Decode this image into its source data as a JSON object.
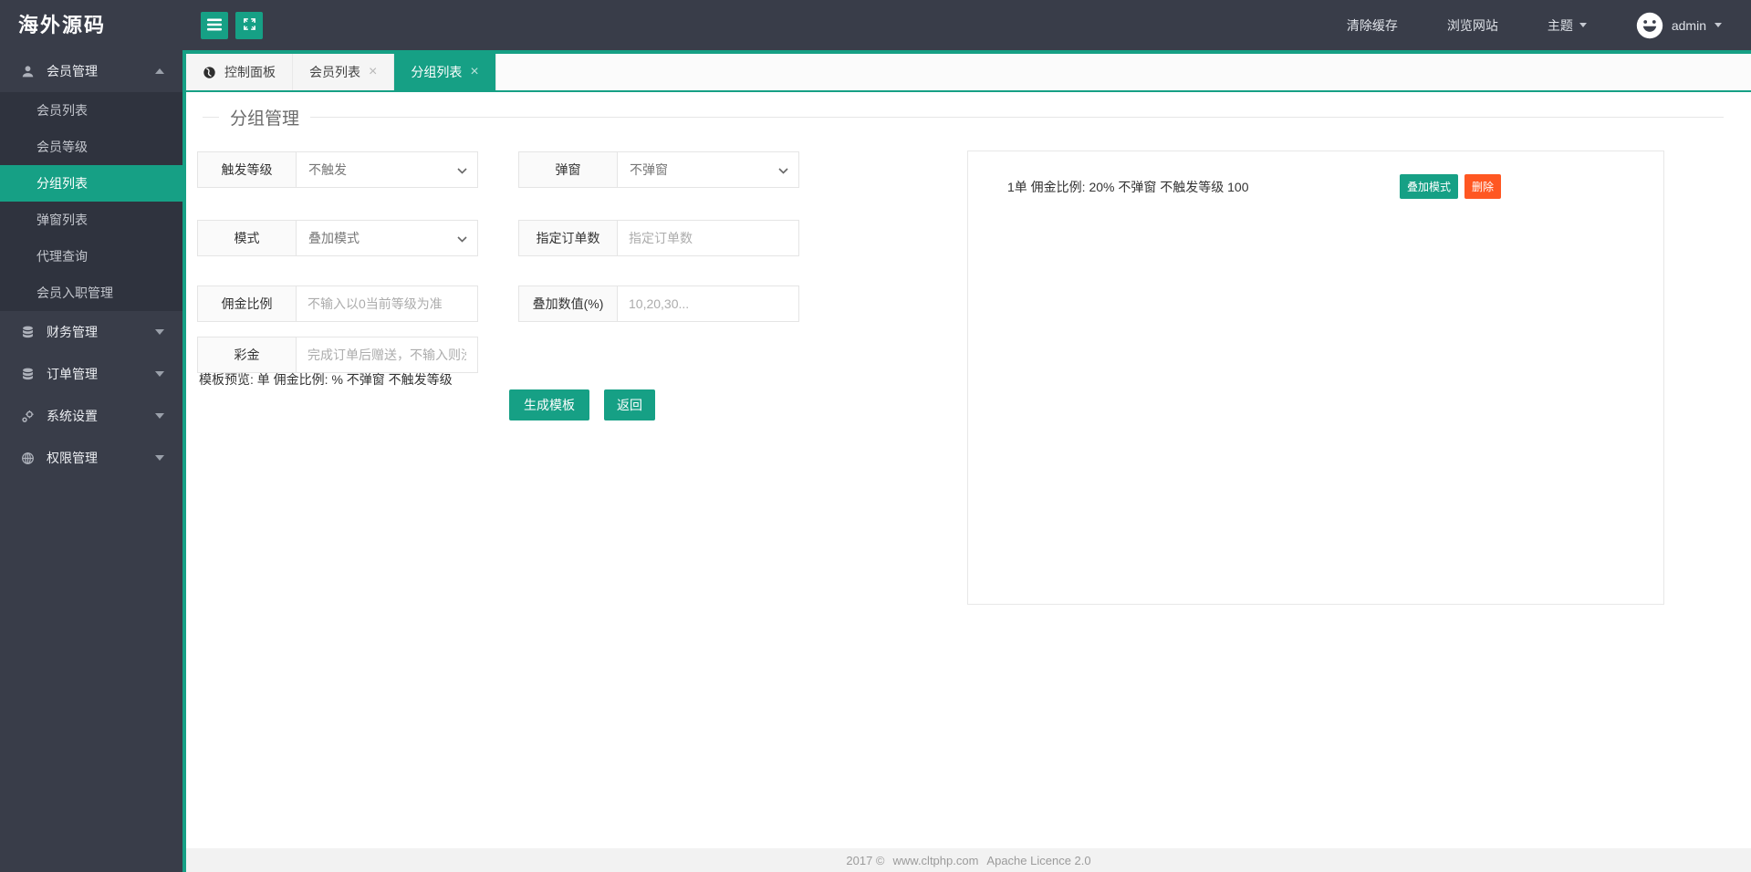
{
  "app": {
    "logo": "海外源码"
  },
  "topbar": {
    "clear_cache": "清除缓存",
    "visit_site": "浏览网站",
    "theme": "主题",
    "user": "admin"
  },
  "sidebar": {
    "groups": [
      {
        "label": "会员管理",
        "icon": "user-icon",
        "expanded": true,
        "children": [
          {
            "label": "会员列表"
          },
          {
            "label": "会员等级"
          },
          {
            "label": "分组列表",
            "active": true
          },
          {
            "label": "弹窗列表"
          },
          {
            "label": "代理查询"
          },
          {
            "label": "会员入职管理"
          }
        ]
      },
      {
        "label": "财务管理",
        "icon": "database-icon"
      },
      {
        "label": "订单管理",
        "icon": "database-icon"
      },
      {
        "label": "系统设置",
        "icon": "gear-icon"
      },
      {
        "label": "权限管理",
        "icon": "globe-icon"
      }
    ]
  },
  "tabs": [
    {
      "label": "控制面板",
      "icon": "globe-icon"
    },
    {
      "label": "会员列表",
      "closable": true
    },
    {
      "label": "分组列表",
      "closable": true,
      "active": true
    }
  ],
  "page": {
    "title": "分组管理"
  },
  "form": {
    "fields": [
      {
        "label": "触发等级",
        "type": "select",
        "value": "不触发"
      },
      {
        "label": "弹窗",
        "type": "select",
        "value": "不弹窗"
      },
      {
        "label": "模式",
        "type": "select",
        "value": "叠加模式"
      },
      {
        "label": "指定订单数",
        "type": "input",
        "placeholder": "指定订单数"
      },
      {
        "label": "佣金比例",
        "type": "input",
        "placeholder": "不输入以0当前等级为准"
      },
      {
        "label": "叠加数值(%)",
        "type": "input",
        "placeholder": "10,20,30..."
      },
      {
        "label": "彩金",
        "type": "input",
        "placeholder": "完成订单后赠送，不输入则没有"
      }
    ],
    "preview": "模板预览: 单 佣金比例: % 不弹窗 不触发等级",
    "submit_label": "生成模板",
    "back_label": "返回"
  },
  "panel": {
    "items": [
      {
        "text": "1单 佣金比例: 20% 不弹窗 不触发等级 100",
        "mode_label": "叠加模式",
        "delete_label": "删除"
      }
    ]
  },
  "footer": {
    "year": "2017 ©",
    "site": "www.cltphp.com",
    "license": "Apache Licence 2.0"
  },
  "icons": {
    "close": "×"
  },
  "colors": {
    "accent": "#16a085",
    "danger": "#FF5722",
    "header_bg": "#393D49",
    "submenu_bg": "#2F333E"
  }
}
